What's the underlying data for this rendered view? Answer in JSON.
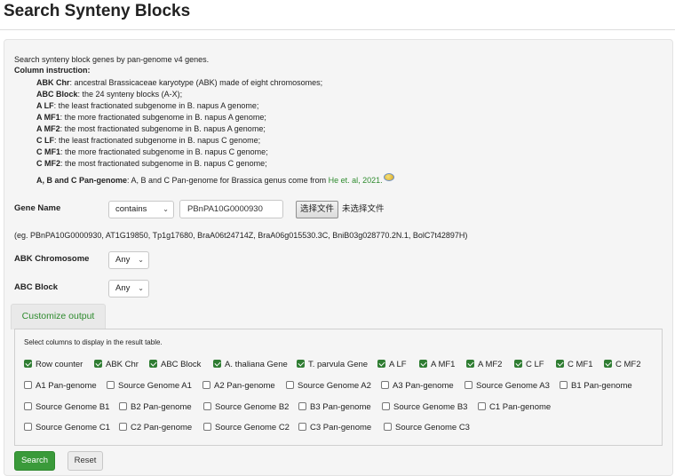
{
  "page": {
    "title": "Search Synteny Blocks"
  },
  "intro": {
    "line1": "Search synteny block genes by pan-genome v4 genes.",
    "column_heading": "Column instruction:",
    "items": [
      {
        "term": "ABK Chr",
        "desc": ": ancestral Brassicaceae karyotype (ABK) made of eight chromosomes;"
      },
      {
        "term": "ABC Block",
        "desc": ": the 24 synteny blocks (A-X);"
      },
      {
        "term": "A LF",
        "desc": ": the least fractionated subgenome in B. napus A genome;"
      },
      {
        "term": "A MF1",
        "desc": ": the more fractionated subgenome in B. napus A genome;"
      },
      {
        "term": "A MF2",
        "desc": ": the most fractionated subgenome in B. napus A genome;"
      },
      {
        "term": "C LF",
        "desc": ": the least fractionated subgenome in B. napus C genome;"
      },
      {
        "term": "C MF1",
        "desc": ": the more fractionated subgenome in B. napus C genome;"
      },
      {
        "term": "C MF2",
        "desc": ": the most fractionated subgenome in B. napus C genome;"
      }
    ],
    "pan_term": "A, B and C Pan-genome",
    "pan_desc": ": A, B and C Pan-genome for Brassica genus come from ",
    "pan_link": "He et. al, 2021."
  },
  "form": {
    "gene_name_label": "Gene Name",
    "match_select": "contains",
    "gene_input_value": "PBnPA10G0000930",
    "file_button": "选择文件",
    "file_status": "未选择文件",
    "example": "(eg. PBnPA10G0000930, AT1G19850, Tp1g17680, BraA06t24714Z, BraA06g015530.3C, BniB03g028770.2N.1, BolC7t42897H)",
    "abk_label": "ABK Chromosome",
    "abk_value": "Any",
    "abc_label": "ABC Block",
    "abc_value": "Any"
  },
  "customize": {
    "tab_label": "Customize output",
    "instruction": "Select columns to display in the result table.",
    "row1": [
      {
        "label": "Row counter",
        "checked": true
      },
      {
        "label": "ABK Chr",
        "checked": true
      },
      {
        "label": "ABC Block",
        "checked": true
      },
      {
        "label": "A. thaliana Gene",
        "checked": true
      },
      {
        "label": "T. parvula Gene",
        "checked": true
      },
      {
        "label": "A LF",
        "checked": true
      },
      {
        "label": "A MF1",
        "checked": true
      },
      {
        "label": "A MF2",
        "checked": true
      },
      {
        "label": "C LF",
        "checked": true
      },
      {
        "label": "C MF1",
        "checked": true
      },
      {
        "label": "C MF2",
        "checked": true
      }
    ],
    "row2": [
      {
        "label": "A1 Pan-genome",
        "checked": false
      },
      {
        "label": "Source Genome A1",
        "checked": false
      },
      {
        "label": "A2 Pan-genome",
        "checked": false
      },
      {
        "label": "Source Genome A2",
        "checked": false
      },
      {
        "label": "A3 Pan-genome",
        "checked": false
      },
      {
        "label": "Source Genome A3",
        "checked": false
      },
      {
        "label": "B1 Pan-genome",
        "checked": false
      }
    ],
    "row3": [
      {
        "label": "Source Genome B1",
        "checked": false
      },
      {
        "label": "B2 Pan-genome",
        "checked": false
      },
      {
        "label": "Source Genome B2",
        "checked": false
      },
      {
        "label": "B3 Pan-genome",
        "checked": false
      },
      {
        "label": "Source Genome B3",
        "checked": false
      },
      {
        "label": "C1 Pan-genome",
        "checked": false
      }
    ],
    "row4": [
      {
        "label": "Source Genome C1",
        "checked": false
      },
      {
        "label": "C2 Pan-genome",
        "checked": false
      },
      {
        "label": "Source Genome C2",
        "checked": false
      },
      {
        "label": "C3 Pan-genome",
        "checked": false
      },
      {
        "label": "Source Genome C3",
        "checked": false
      }
    ]
  },
  "buttons": {
    "search": "Search",
    "reset": "Reset"
  }
}
